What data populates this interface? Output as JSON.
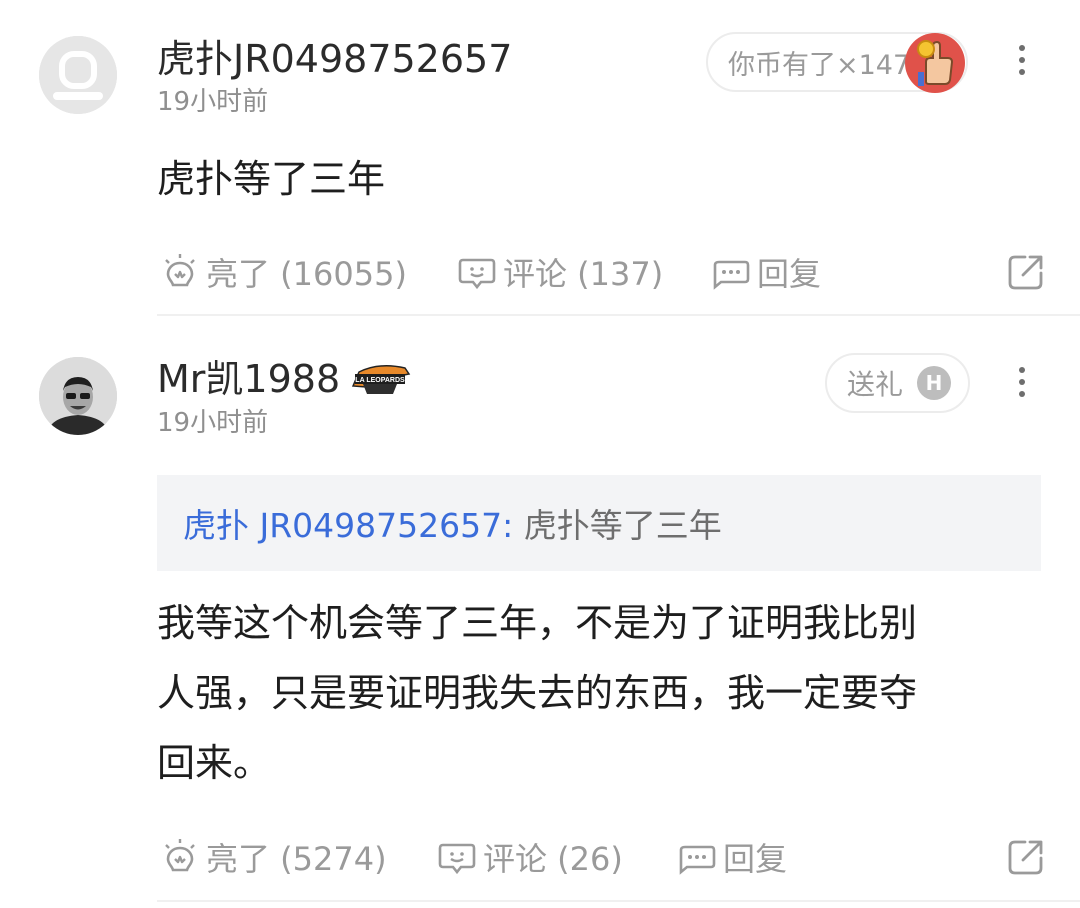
{
  "comments": [
    {
      "username": "虎扑JR0498752657",
      "time": "19小时前",
      "text": "虎扑等了三年",
      "pill_label": "你币有了×147",
      "actions": {
        "like": "亮了 (16055)",
        "comment": "评论 (137)",
        "reply": "回复"
      }
    },
    {
      "username": "Mr凯1988",
      "time": "19小时前",
      "quote_user": "虎扑 JR0498752657:",
      "quote_text": " 虎扑等了三年",
      "text_lines": [
        "我等这个机会等了三年，不是为了证明我比别",
        "人强，只是要证明我失去的东西，我一定要夺",
        "回来。"
      ],
      "pill_label": "送礼",
      "badge_letter": "H",
      "team_badge_text": "LA LEOPARDS",
      "actions": {
        "like": "亮了 (5274)",
        "comment": "评论 (26)",
        "reply": "回复"
      }
    }
  ],
  "colors": {
    "link_blue": "#3a6cd9",
    "muted": "#9a9a9a",
    "quote_bg": "#f3f4f6"
  }
}
